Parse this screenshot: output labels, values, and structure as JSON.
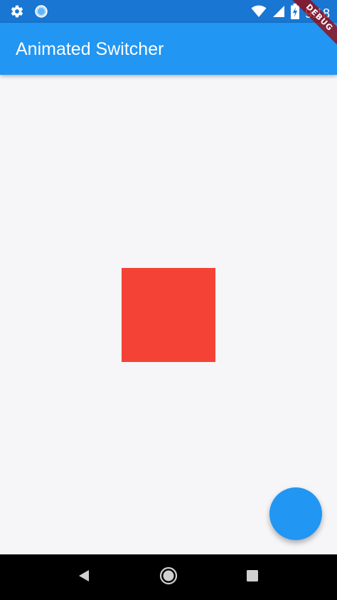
{
  "status_bar": {
    "time": "9:18",
    "icons": [
      "gear-icon",
      "sync-circle-icon",
      "wifi-icon",
      "signal-icon",
      "battery-charging-icon"
    ]
  },
  "app_bar": {
    "title": "Animated Switcher",
    "color": "#2196f3"
  },
  "debug_banner": {
    "label": "DEBUG"
  },
  "content": {
    "switcher_box_color": "#f44336",
    "background_color": "#f6f6f8"
  },
  "fab": {
    "color": "#2196f3"
  },
  "nav_bar": {
    "buttons": [
      "back-icon",
      "home-icon",
      "recents-icon"
    ]
  }
}
